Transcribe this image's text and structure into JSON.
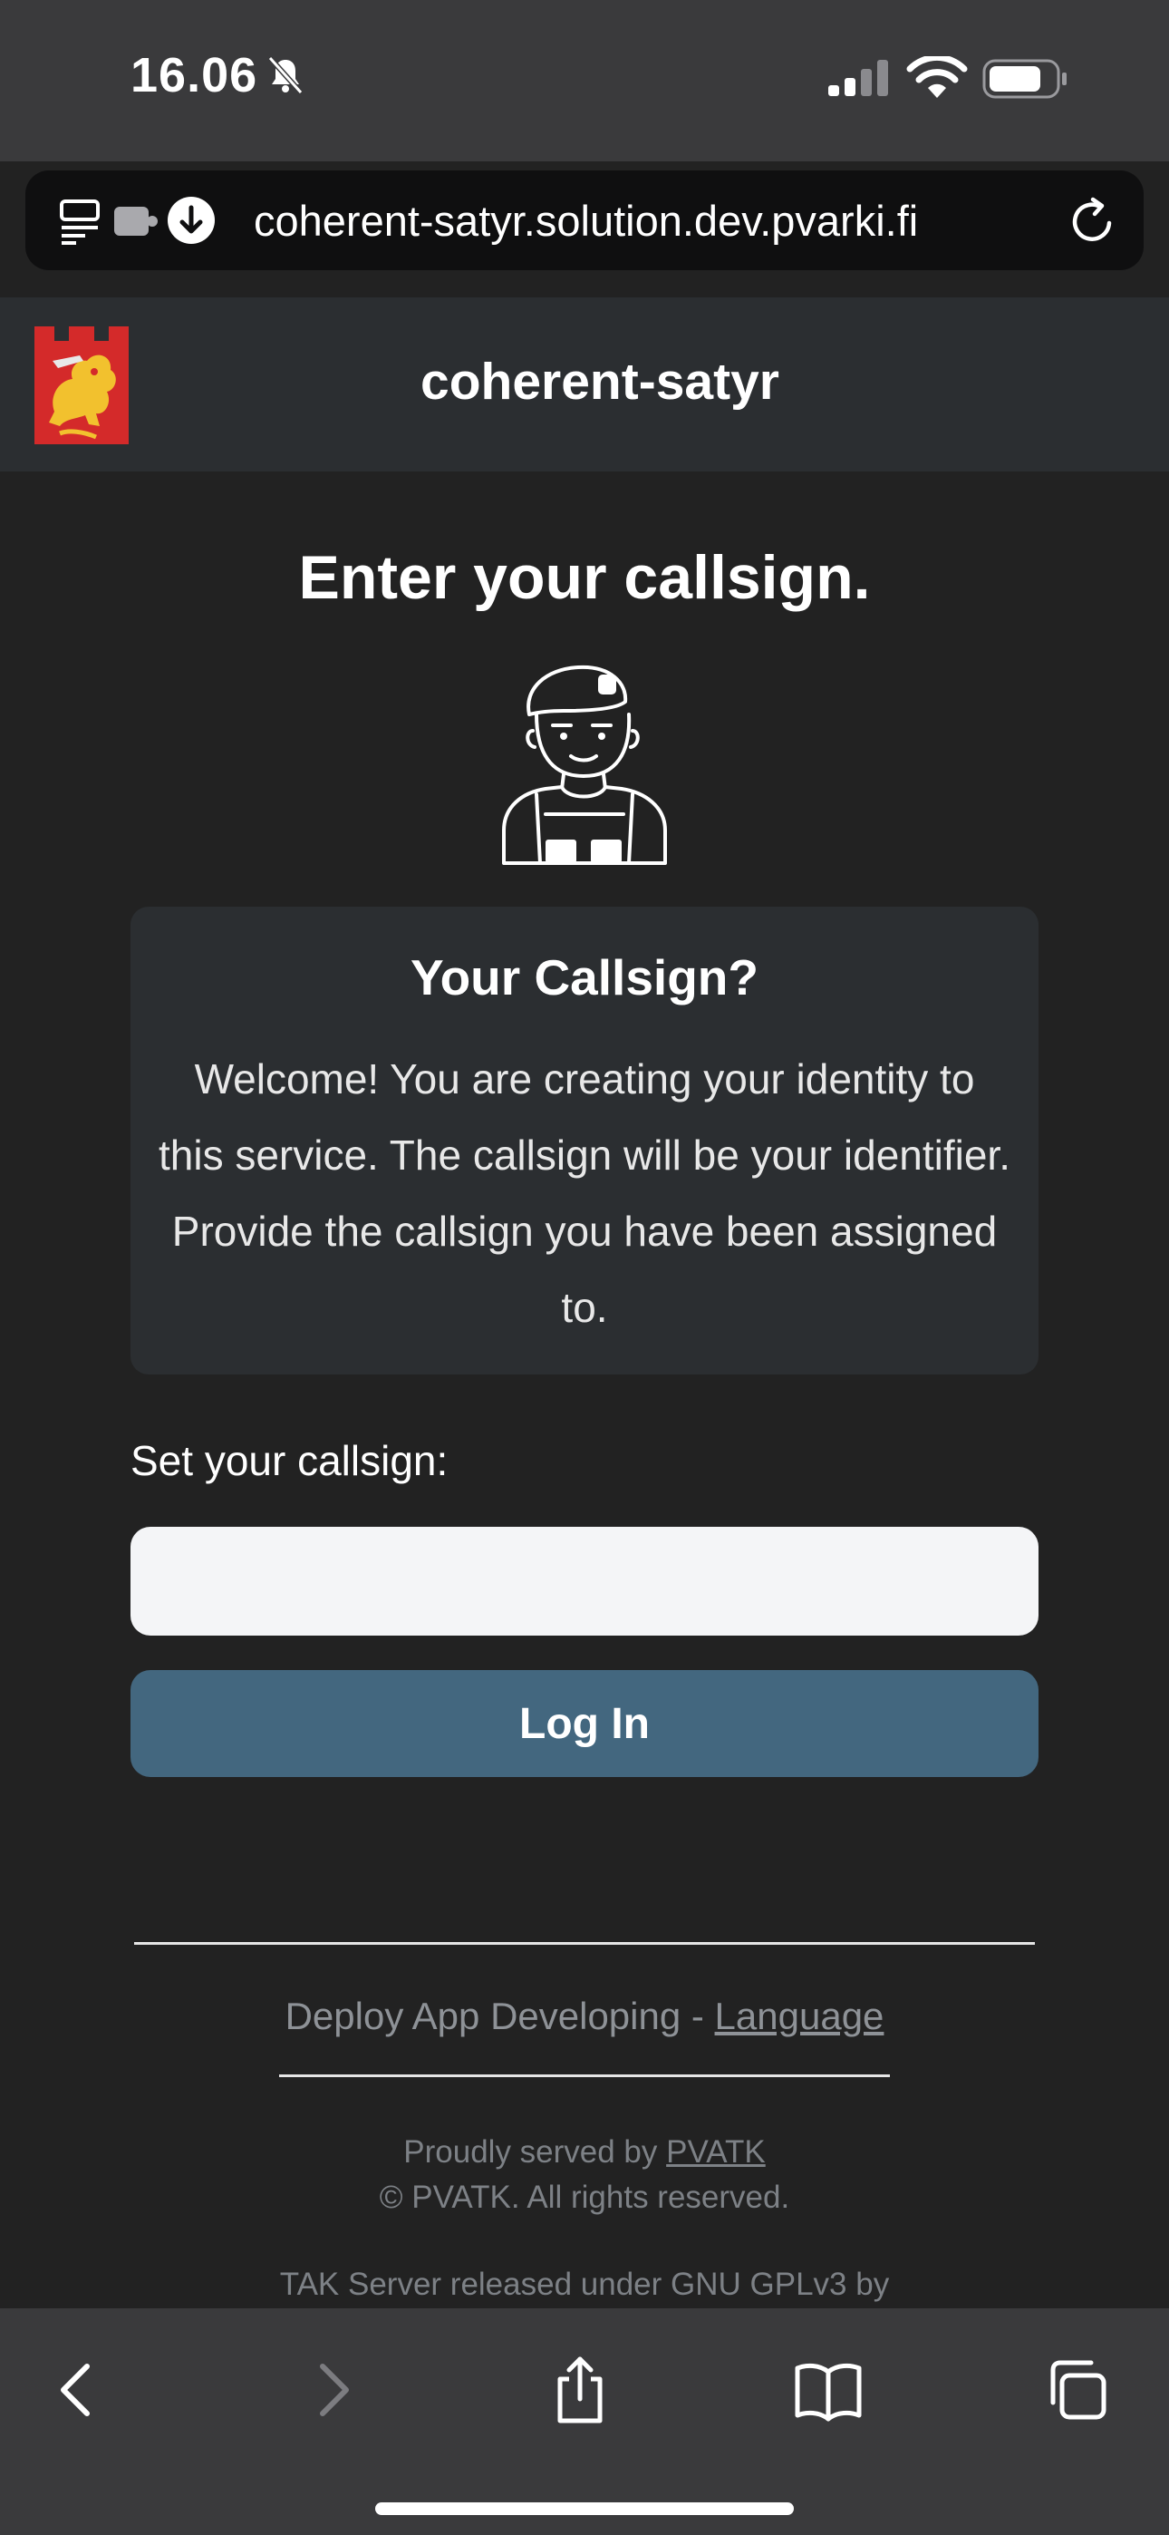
{
  "status_bar": {
    "time": "16.06"
  },
  "browser": {
    "url": "coherent-satyr.solution.dev.pvarki.fi"
  },
  "header": {
    "site_title": "coherent-satyr"
  },
  "main": {
    "page_title": "Enter your callsign.",
    "card_title": "Your Callsign?",
    "card_text": "Welcome! You are creating your identity to this service. The callsign will be your identifier. Provide the callsign you have been assigned to.",
    "field_label": "Set your callsign:",
    "input_value": "",
    "login_label": "Log In"
  },
  "footer": {
    "deploy_text": "Deploy App Developing - ",
    "language_link": "Language",
    "served_text": "Proudly served by ",
    "served_link": "PVATK",
    "rights": "© PVATK. All rights reserved.",
    "tak_text": "TAK Server released under GNU GPLv3 by"
  },
  "colors": {
    "background": "#222222",
    "header_bg": "#2b2e31",
    "button_bg": "#43677f",
    "logo_red": "#d42a2a",
    "logo_gold": "#f2c12e"
  },
  "icons": {
    "status": [
      "bell-slash-icon",
      "signal-icon",
      "wifi-icon",
      "battery-icon"
    ],
    "url_bar": [
      "tabs-overview-icon",
      "extension-icon",
      "download-icon",
      "reload-icon"
    ],
    "toolbar": [
      "back-icon",
      "forward-icon",
      "share-icon",
      "bookmarks-icon",
      "tabs-icon"
    ]
  }
}
